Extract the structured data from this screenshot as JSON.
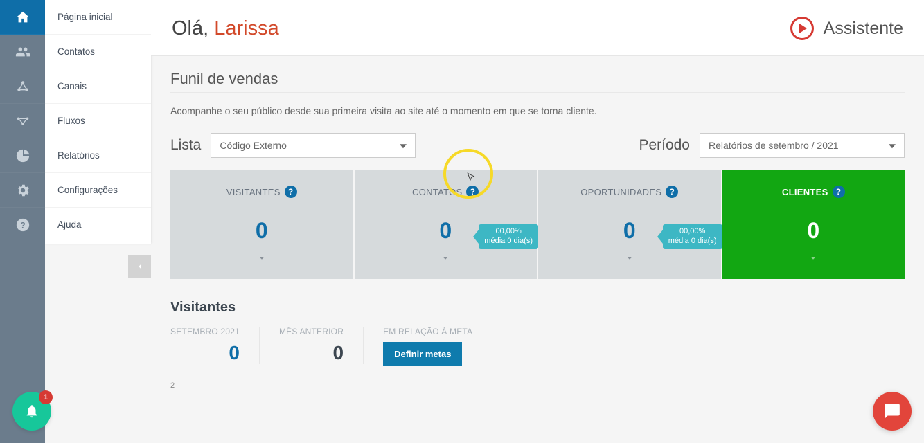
{
  "sidebar": {
    "items": [
      {
        "label": "Página inicial"
      },
      {
        "label": "Contatos"
      },
      {
        "label": "Canais"
      },
      {
        "label": "Fluxos"
      },
      {
        "label": "Relatórios"
      },
      {
        "label": "Configurações"
      },
      {
        "label": "Ajuda"
      }
    ]
  },
  "header": {
    "greeting_prefix": "Olá, ",
    "user_name": "Larissa",
    "assistente_label": "Assistente"
  },
  "funnel": {
    "title": "Funil de vendas",
    "description": "Acompanhe o seu público desde sua primeira visita ao site até o momento em que se torna cliente.",
    "list_label": "Lista",
    "list_value": "Código Externo",
    "period_label": "Período",
    "period_value": "Relatórios de setembro / 2021",
    "cards": [
      {
        "title": "VISITANTES",
        "value": "0"
      },
      {
        "title": "CONTATOS",
        "value": "0"
      },
      {
        "title": "OPORTUNIDADES",
        "value": "0"
      },
      {
        "title": "CLIENTES",
        "value": "0"
      }
    ],
    "conversion": {
      "percent": "00,00%",
      "avg": "média 0 dia(s)"
    }
  },
  "details": {
    "title": "Visitantes",
    "current_label": "SETEMBRO 2021",
    "current_value": "0",
    "prev_label": "MÊS ANTERIOR",
    "prev_value": "0",
    "goal_label": "EM RELAÇÃO À META",
    "goal_button": "Definir metas"
  },
  "chart_data": {
    "type": "bar",
    "categories": [],
    "values": [],
    "ylim": [
      0,
      2
    ],
    "y_tick": "2"
  },
  "notifications": {
    "count": "1"
  }
}
